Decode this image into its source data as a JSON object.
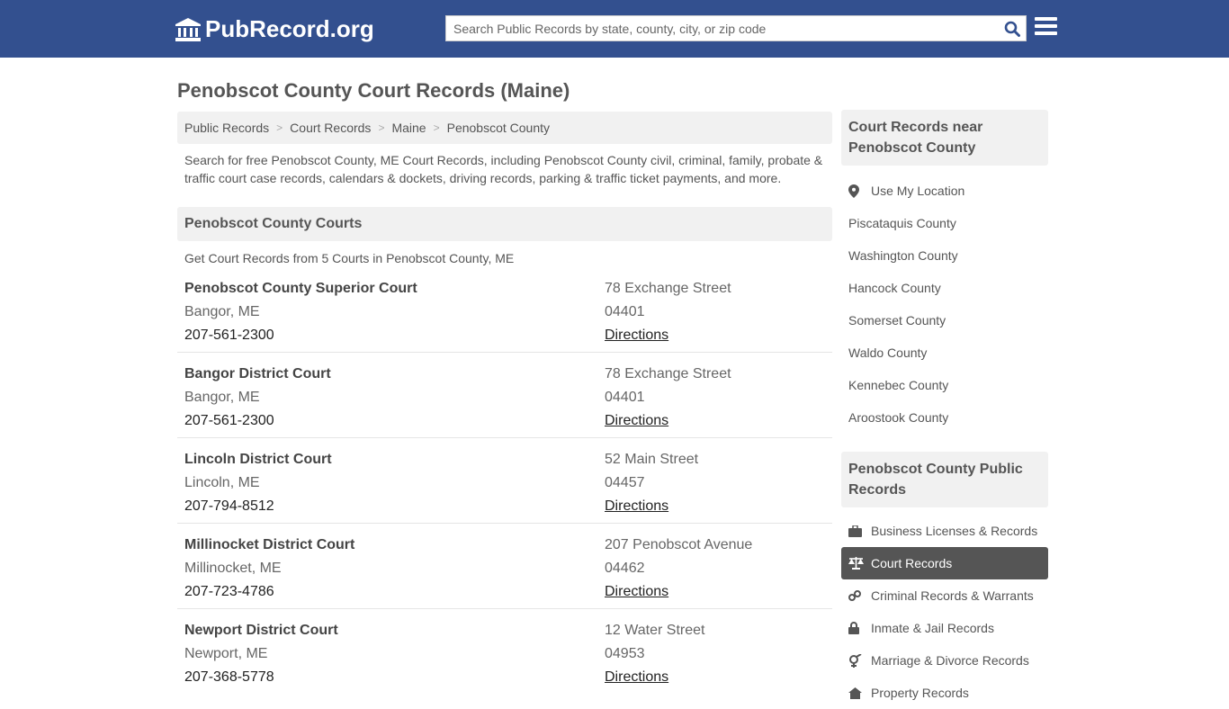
{
  "header": {
    "logo_text": "PubRecord.org",
    "search_placeholder": "Search Public Records by state, county, city, or zip code"
  },
  "page_title": "Penobscot County Court Records (Maine)",
  "breadcrumb": [
    "Public Records",
    "Court Records",
    "Maine",
    "Penobscot County"
  ],
  "intro": "Search for free Penobscot County, ME Court Records, including Penobscot County civil, criminal, family, probate & traffic court case records, calendars & dockets, driving records, parking & traffic ticket payments, and more.",
  "courts_section": {
    "title": "Penobscot County Courts",
    "subtitle": "Get Court Records from 5 Courts in Penobscot County, ME",
    "directions_label": "Directions",
    "courts": [
      {
        "name": "Penobscot County Superior Court",
        "city": "Bangor, ME",
        "phone": "207-561-2300",
        "street": "78 Exchange Street",
        "zip": "04401"
      },
      {
        "name": "Bangor District Court",
        "city": "Bangor, ME",
        "phone": "207-561-2300",
        "street": "78 Exchange Street",
        "zip": "04401"
      },
      {
        "name": "Lincoln District Court",
        "city": "Lincoln, ME",
        "phone": "207-794-8512",
        "street": "52 Main Street",
        "zip": "04457"
      },
      {
        "name": "Millinocket District Court",
        "city": "Millinocket, ME",
        "phone": "207-723-4786",
        "street": "207 Penobscot Avenue",
        "zip": "04462"
      },
      {
        "name": "Newport District Court",
        "city": "Newport, ME",
        "phone": "207-368-5778",
        "street": "12 Water Street",
        "zip": "04953"
      }
    ]
  },
  "sidebar_nearby": {
    "title": "Court Records near Penobscot County",
    "use_location": "Use My Location",
    "counties": [
      "Piscataquis County",
      "Washington County",
      "Hancock County",
      "Somerset County",
      "Waldo County",
      "Kennebec County",
      "Aroostook County"
    ]
  },
  "sidebar_records": {
    "title": "Penobscot County Public Records",
    "items": [
      {
        "label": "Business Licenses & Records",
        "icon": "briefcase-icon"
      },
      {
        "label": "Court Records",
        "icon": "scale-icon",
        "active": true
      },
      {
        "label": "Criminal Records & Warrants",
        "icon": "link-icon"
      },
      {
        "label": "Inmate & Jail Records",
        "icon": "lock-icon"
      },
      {
        "label": "Marriage & Divorce Records",
        "icon": "gender-icon"
      },
      {
        "label": "Property Records",
        "icon": "home-icon"
      }
    ]
  },
  "colors": {
    "header_bg": "#33508f",
    "active_bg": "#555555",
    "search_icon": "#33508f"
  }
}
